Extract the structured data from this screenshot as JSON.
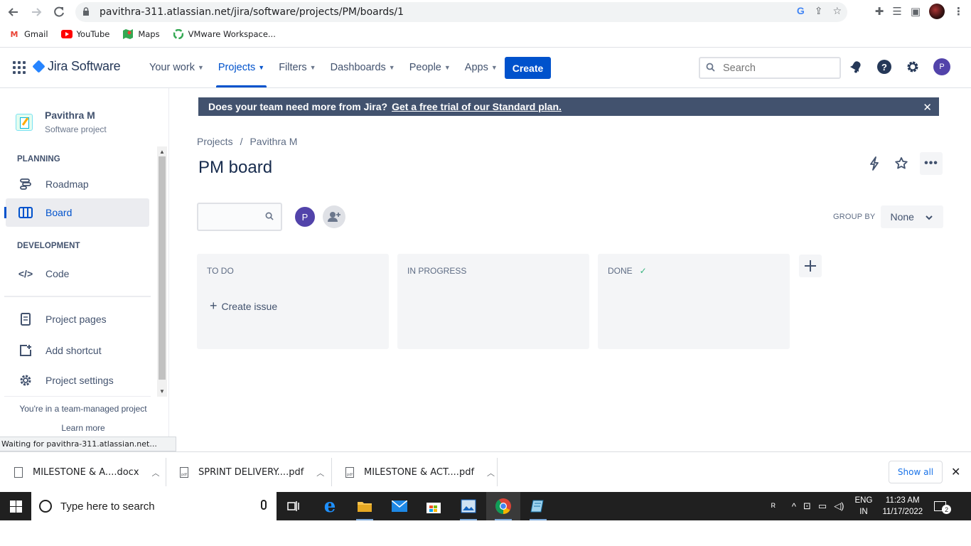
{
  "browser": {
    "url": "pavithra-311.atlassian.net/jira/software/projects/PM/boards/1",
    "bookmarks": [
      {
        "label": "Gmail",
        "icon": "gmail-icon"
      },
      {
        "label": "YouTube",
        "icon": "youtube-icon"
      },
      {
        "label": "Maps",
        "icon": "maps-icon"
      },
      {
        "label": "VMware Workspace...",
        "icon": "vmware-icon"
      }
    ],
    "status_text": "Waiting for pavithra-311.atlassian.net..."
  },
  "jira_nav": {
    "product_name": "Jira Software",
    "items": [
      {
        "label": "Your work",
        "active": false
      },
      {
        "label": "Projects",
        "active": true
      },
      {
        "label": "Filters",
        "active": false
      },
      {
        "label": "Dashboards",
        "active": false
      },
      {
        "label": "People",
        "active": false
      },
      {
        "label": "Apps",
        "active": false
      }
    ],
    "create_label": "Create",
    "search_placeholder": "Search",
    "avatar_initial": "P"
  },
  "sidebar": {
    "project_name": "Pavithra M",
    "project_type": "Software project",
    "planning_heading": "PLANNING",
    "roadmap_label": "Roadmap",
    "board_label": "Board",
    "development_heading": "DEVELOPMENT",
    "code_label": "Code",
    "project_pages_label": "Project pages",
    "add_shortcut_label": "Add shortcut",
    "project_settings_label": "Project settings",
    "footer_text": "You're in a team-managed project",
    "learn_more": "Learn more"
  },
  "banner": {
    "text": "Does your team need more from Jira?",
    "link": "Get a free trial of our Standard plan."
  },
  "main": {
    "breadcrumb": [
      "Projects",
      "/",
      "Pavithra M"
    ],
    "title": "PM board",
    "board_avatar": "P",
    "group_by_label": "GROUP BY",
    "group_by_value": "None",
    "columns": [
      {
        "title": "TO DO",
        "action": "Create issue"
      },
      {
        "title": "IN PROGRESS"
      },
      {
        "title": "DONE"
      }
    ]
  },
  "downloads": {
    "items": [
      "MILESTONE & A....docx",
      "SPRINT DELIVERY....pdf",
      "MILESTONE & ACT....pdf"
    ],
    "show_all": "Show all"
  },
  "taskbar": {
    "search_placeholder": "Type here to search",
    "lang_top": "ENG",
    "lang_bottom": "IN",
    "time": "11:23 AM",
    "date": "11/17/2022",
    "notification_count": "2"
  },
  "colors": {
    "jira_blue": "#0052cc",
    "banner_bg": "#42526e",
    "avatar_purple": "#5243aa",
    "done_check": "#36b37e"
  }
}
